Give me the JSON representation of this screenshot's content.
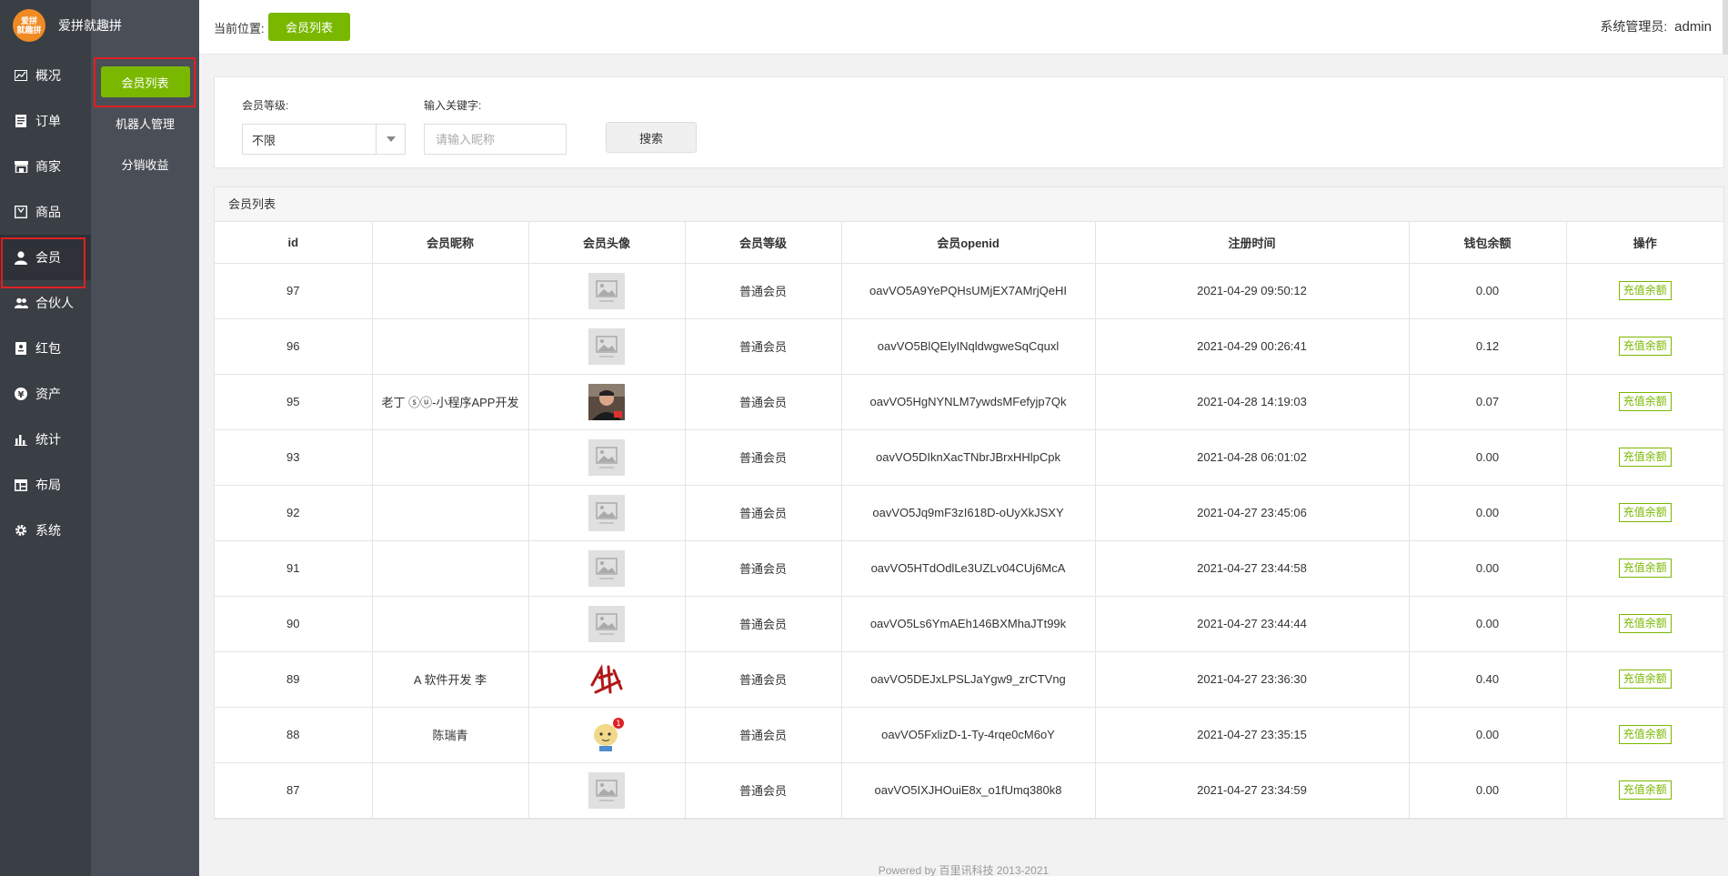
{
  "brand": {
    "logo_text": "爱拼就趣拼",
    "name": "爱拼就趣拼"
  },
  "nav": [
    {
      "label": "概况",
      "icon": "dashboard-icon"
    },
    {
      "label": "订单",
      "icon": "order-icon"
    },
    {
      "label": "商家",
      "icon": "store-icon"
    },
    {
      "label": "商品",
      "icon": "goods-icon"
    },
    {
      "label": "会员",
      "icon": "user-icon"
    },
    {
      "label": "合伙人",
      "icon": "partner-icon"
    },
    {
      "label": "红包",
      "icon": "redpacket-icon"
    },
    {
      "label": "资产",
      "icon": "yen-icon"
    },
    {
      "label": "统计",
      "icon": "stats-icon"
    },
    {
      "label": "布局",
      "icon": "layout-icon"
    },
    {
      "label": "系统",
      "icon": "gear-icon"
    }
  ],
  "subnav": [
    {
      "label": "会员列表"
    },
    {
      "label": "机器人管理"
    },
    {
      "label": "分销收益"
    }
  ],
  "header": {
    "location_label": "当前位置:",
    "location": "会员列表",
    "admin_label": "系统管理员:",
    "admin_user": "admin"
  },
  "search": {
    "level_label": "会员等级:",
    "level_value": "不限",
    "keyword_label": "输入关键字:",
    "keyword_placeholder": "请输入昵称",
    "button": "搜索"
  },
  "table": {
    "title": "会员列表",
    "columns": [
      "id",
      "会员昵称",
      "会员头像",
      "会员等级",
      "会员openid",
      "注册时间",
      "钱包余额",
      "操作"
    ],
    "action_label": "充值余额",
    "rows": [
      {
        "id": "97",
        "nickname": "",
        "avatar": "placeholder",
        "level": "普通会员",
        "openid": "oavVO5A9YePQHsUMjEX7AMrjQeHI",
        "time": "2021-04-29 09:50:12",
        "balance": "0.00"
      },
      {
        "id": "96",
        "nickname": "",
        "avatar": "placeholder",
        "level": "普通会员",
        "openid": "oavVO5BlQElyINqldwgweSqCquxl",
        "time": "2021-04-29 00:26:41",
        "balance": "0.12"
      },
      {
        "id": "95",
        "nickname": "老丁 ⓢⓤ-小程序APP开发",
        "avatar": "photo-man",
        "level": "普通会员",
        "openid": "oavVO5HgNYNLM7ywdsMFefyjp7Qk",
        "time": "2021-04-28 14:19:03",
        "balance": "0.07"
      },
      {
        "id": "93",
        "nickname": "",
        "avatar": "placeholder",
        "level": "普通会员",
        "openid": "oavVO5DIknXacTNbrJBrxHHlpCpk",
        "time": "2021-04-28 06:01:02",
        "balance": "0.00"
      },
      {
        "id": "92",
        "nickname": "",
        "avatar": "placeholder",
        "level": "普通会员",
        "openid": "oavVO5Jq9mF3zI618D-oUyXkJSXY",
        "time": "2021-04-27 23:45:06",
        "balance": "0.00"
      },
      {
        "id": "91",
        "nickname": "",
        "avatar": "placeholder",
        "level": "普通会员",
        "openid": "oavVO5HTdOdlLe3UZLv04CUj6McA",
        "time": "2021-04-27 23:44:58",
        "balance": "0.00"
      },
      {
        "id": "90",
        "nickname": "",
        "avatar": "placeholder",
        "level": "普通会员",
        "openid": "oavVO5Ls6YmAEh146BXMhaJTt99k",
        "time": "2021-04-27 23:44:44",
        "balance": "0.00"
      },
      {
        "id": "89",
        "nickname": "A 软件开发 李",
        "avatar": "calligraphy",
        "level": "普通会员",
        "openid": "oavVO5DEJxLPSLJaYgw9_zrCTVng",
        "time": "2021-04-27 23:36:30",
        "balance": "0.40"
      },
      {
        "id": "88",
        "nickname": "陈瑞青",
        "avatar": "cartoon",
        "level": "普通会员",
        "openid": "oavVO5FxlizD-1-Ty-4rqe0cM6oY",
        "time": "2021-04-27 23:35:15",
        "balance": "0.00"
      },
      {
        "id": "87",
        "nickname": "",
        "avatar": "placeholder",
        "level": "普通会员",
        "openid": "oavVO5IXJHOuiE8x_o1fUmq380k8",
        "time": "2021-04-27 23:34:59",
        "balance": "0.00"
      }
    ]
  },
  "footer": "Powered by 百里讯科技 2013-2021",
  "colors": {
    "accent": "#7ab800",
    "sidebar": "#3a3e45",
    "subnav": "#4a4f57",
    "highlight": "#e02020",
    "logo": "#f08a24"
  }
}
